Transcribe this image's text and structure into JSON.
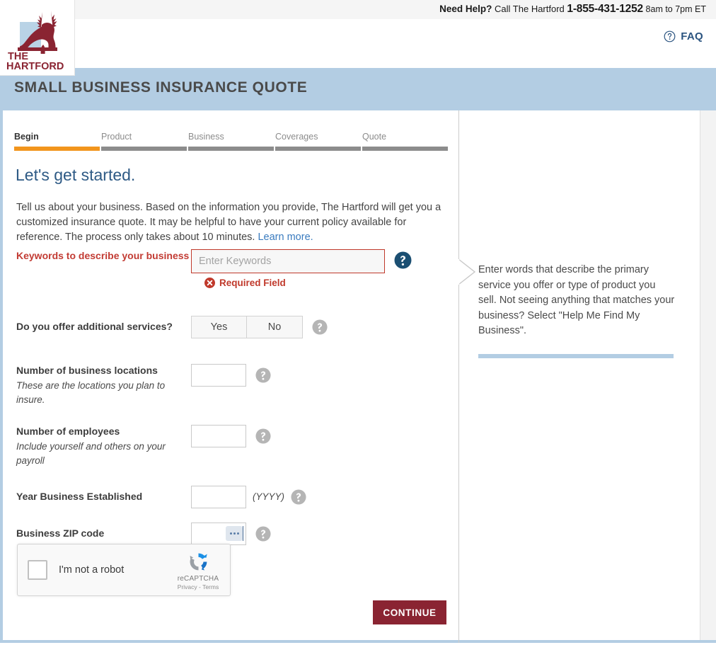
{
  "top_bar": {
    "need_help": "Need Help?",
    "call_text": "Call The Hartford",
    "phone": "1-855-431-1252",
    "hours": "8am to 7pm ET"
  },
  "header": {
    "faq_label": "FAQ",
    "faq_icon": "question-circle-icon",
    "logo_line1": "THE",
    "logo_line2": "HARTFORD",
    "logo_icon": "stag-logo-icon"
  },
  "banner": {
    "title": "SMALL BUSINESS INSURANCE QUOTE",
    "color": "#b3cde3"
  },
  "progress": {
    "steps": [
      {
        "label": "Begin",
        "active": true
      },
      {
        "label": "Product",
        "active": false
      },
      {
        "label": "Business",
        "active": false
      },
      {
        "label": "Coverages",
        "active": false
      },
      {
        "label": "Quote",
        "active": false
      }
    ],
    "active_color": "#f2951d",
    "inactive_color": "#8c8c8c"
  },
  "main": {
    "headline": "Let's get started.",
    "intro_text": "Tell us about your business. Based on the information you provide, The Hartford will get you a customized insurance quote. It may be helpful to have your current policy available for reference. The process only takes about 10 minutes. ",
    "intro_link": "Learn more.",
    "fields": {
      "keywords": {
        "label": "Keywords to describe your business",
        "placeholder": "Enter Keywords",
        "value": "",
        "error": "Required Field",
        "error_icon": "error-circle-x-icon",
        "help_icon": "help-circle-icon-active"
      },
      "additional_services": {
        "label": "Do you offer additional services?",
        "yes_label": "Yes",
        "no_label": "No",
        "selected": "",
        "help_icon": "help-circle-icon"
      },
      "locations": {
        "label": "Number of business locations",
        "hint": "These are the locations you plan to insure.",
        "value": "",
        "help_icon": "help-circle-icon"
      },
      "employees": {
        "label": "Number of employees",
        "hint": "Include yourself and others on your payroll",
        "value": "",
        "help_icon": "help-circle-icon"
      },
      "year_established": {
        "label": "Year Business Established",
        "value": "",
        "format_note": "(YYYY)",
        "help_icon": "help-circle-icon"
      },
      "zip": {
        "label": "Business ZIP code",
        "value": "",
        "autofill_icon": "autofill-dots-icon",
        "help_icon": "help-circle-icon"
      }
    },
    "recaptcha": {
      "checkbox_label": "I'm not a robot",
      "brand": "reCAPTCHA",
      "links": "Privacy - Terms",
      "logo_icon": "recaptcha-logo-icon"
    },
    "continue_label": "CONTINUE"
  },
  "help_panel": {
    "text": "Enter words that describe the primary service you offer or type of product you sell. Not seeing anything that matches your business? Select \"Help Me Find My Business\".",
    "pointer_icon": "chevron-right-pointer-icon"
  }
}
